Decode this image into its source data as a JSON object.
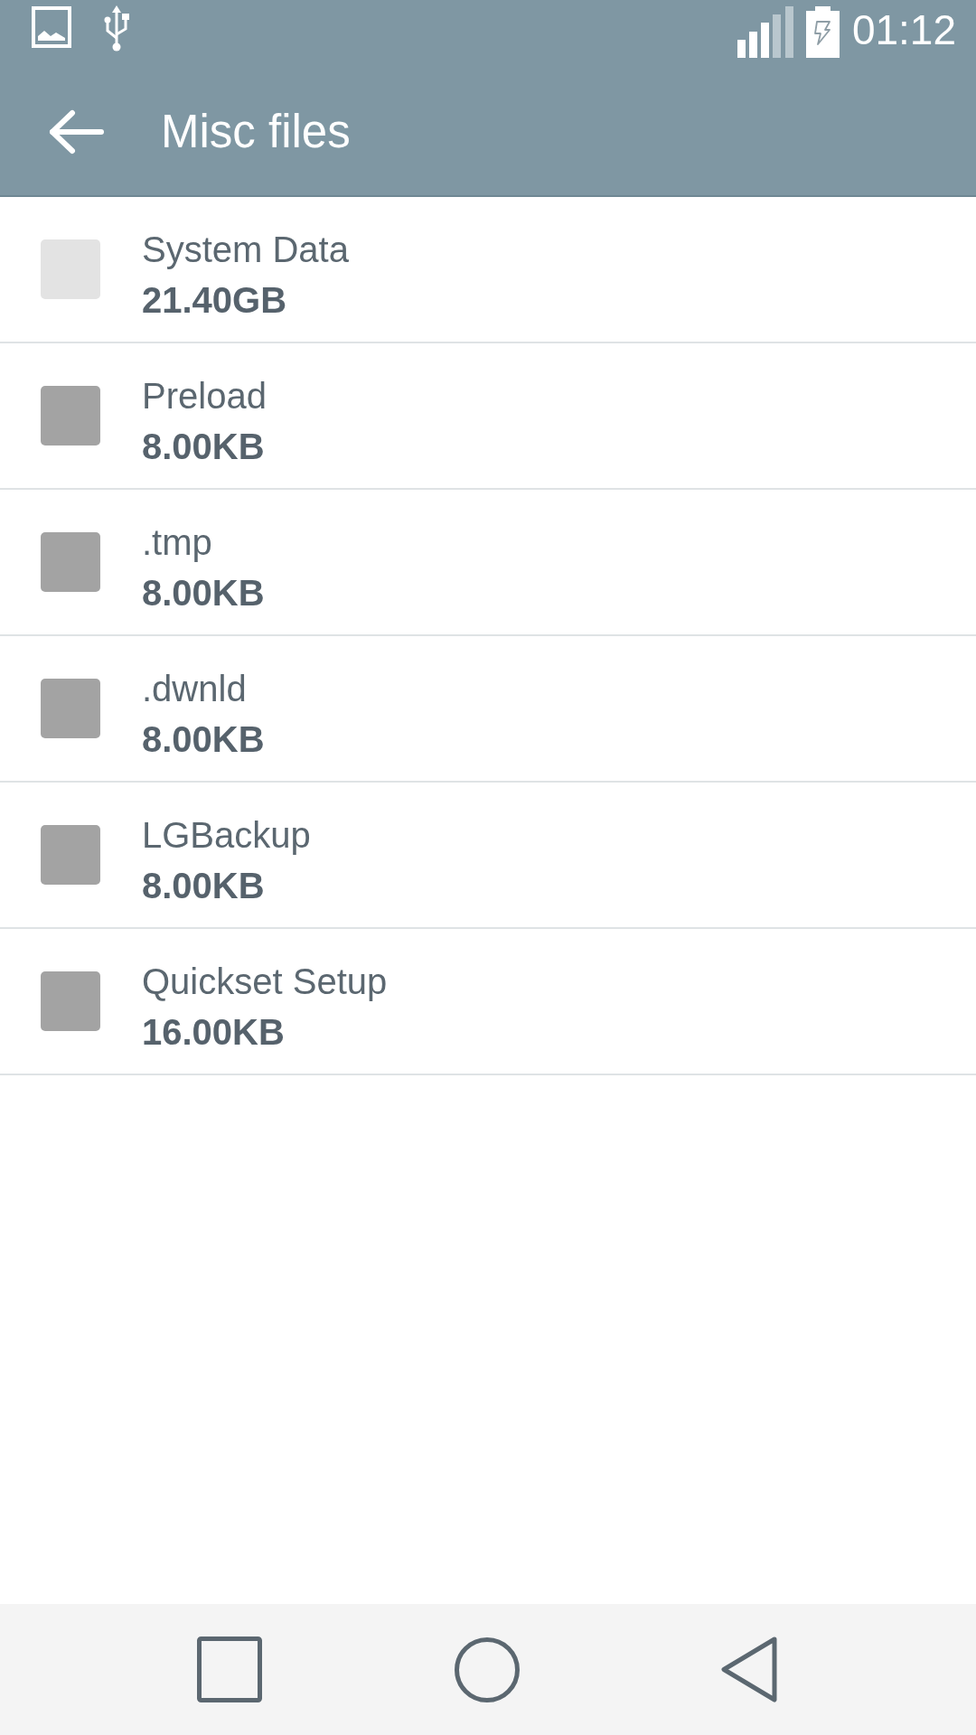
{
  "status_bar": {
    "time": "01:12"
  },
  "app_bar": {
    "title": "Misc files"
  },
  "files": [
    {
      "name": "System Data",
      "size": "21.40GB",
      "checked": false,
      "disabled": true
    },
    {
      "name": "Preload",
      "size": "8.00KB",
      "checked": false,
      "disabled": false
    },
    {
      "name": ".tmp",
      "size": "8.00KB",
      "checked": false,
      "disabled": false
    },
    {
      "name": ".dwnld",
      "size": "8.00KB",
      "checked": false,
      "disabled": false
    },
    {
      "name": "LGBackup",
      "size": "8.00KB",
      "checked": false,
      "disabled": false
    },
    {
      "name": "Quickset Setup",
      "size": "16.00KB",
      "checked": false,
      "disabled": false
    }
  ]
}
